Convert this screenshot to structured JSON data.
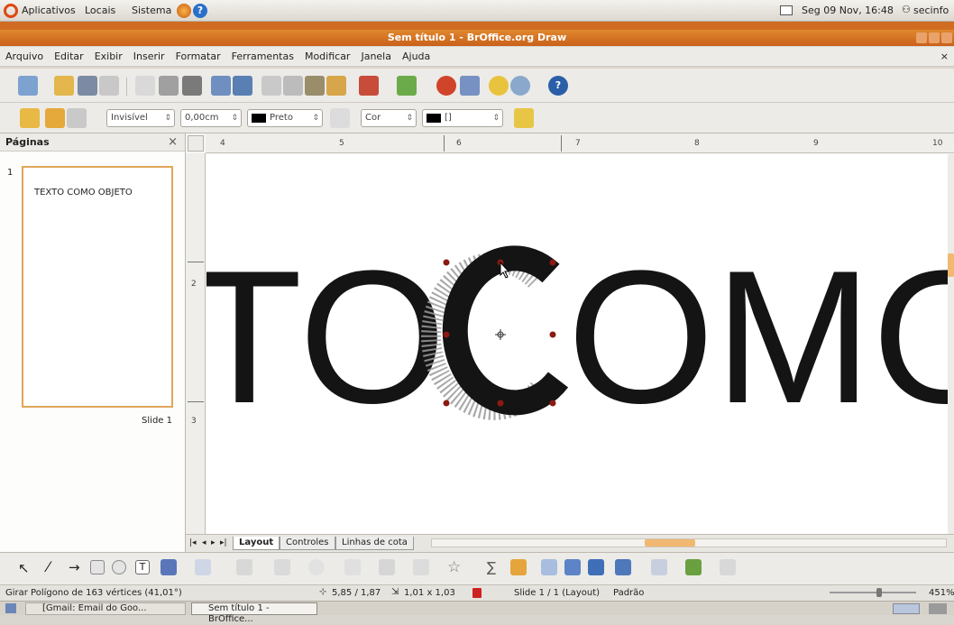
{
  "topbar": {
    "menus": [
      "Aplicativos",
      "Locais",
      "Sistema"
    ],
    "datetime": "Seg 09 Nov, 16:48",
    "user": "secinfo"
  },
  "window": {
    "title": "Sem título 1 - BrOffice.org Draw"
  },
  "menubar": {
    "items": [
      "Arquivo",
      "Editar",
      "Exibir",
      "Inserir",
      "Formatar",
      "Ferramentas",
      "Modificar",
      "Janela",
      "Ajuda"
    ]
  },
  "line_toolbar": {
    "line_style": "Invisível",
    "line_width": "0,00cm",
    "line_color": "Preto",
    "area_style": "Cor",
    "area_color": "[]"
  },
  "pages_panel": {
    "title": "Páginas",
    "page_number": "1",
    "thumb_text": "TEXTO COMO OBJETO",
    "slide_label": "Slide 1"
  },
  "ruler": {
    "h_labels": [
      "4",
      "5",
      "6",
      "7",
      "8",
      "9",
      "10"
    ],
    "v_labels": [
      "2",
      "3"
    ]
  },
  "canvas": {
    "visible_text": "TO COMO"
  },
  "layer_tabs": [
    "Layout",
    "Controles",
    "Linhas de cota"
  ],
  "status": {
    "message": "Girar Polígono de 163 vértices (41,01°)",
    "position": "5,85 / 1,87",
    "size": "1,01 x 1,03",
    "slide": "Slide 1 / 1 (Layout)",
    "style": "Padrão",
    "zoom": "451%"
  },
  "taskbar": {
    "items": [
      "[Gmail: Email do Goo...",
      "Sem título 1 - BrOffice..."
    ]
  },
  "colors": {
    "title_orange": "#d0691f",
    "selection_handle": "#8b1a12"
  }
}
